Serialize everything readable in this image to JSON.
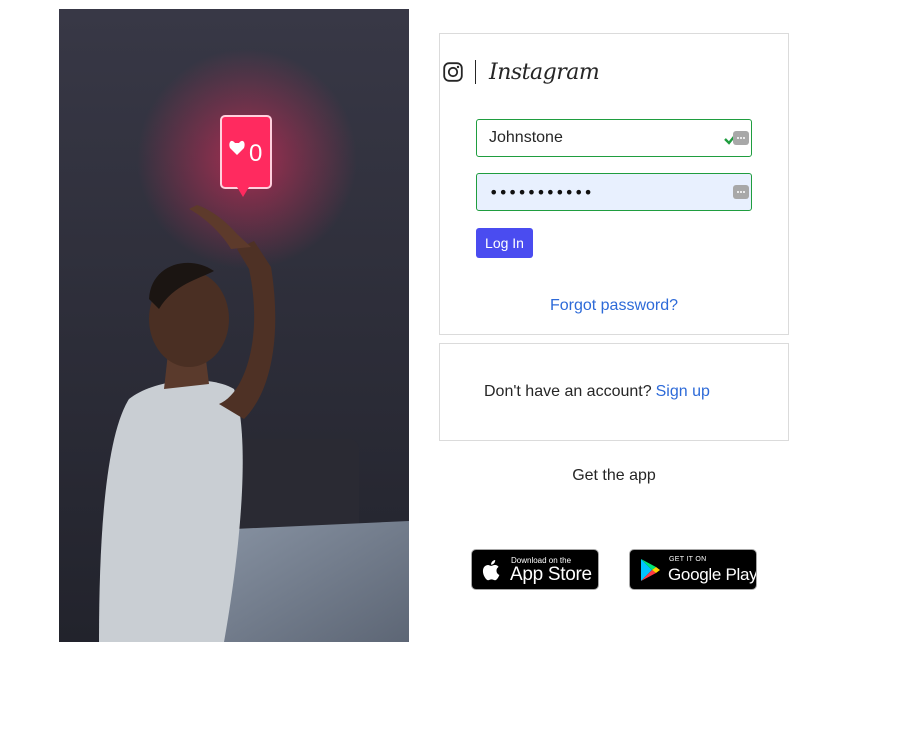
{
  "brand": {
    "wordmark": "Instagram",
    "icon": "instagram-icon"
  },
  "hero": {
    "sign_count": "0",
    "sign_icon": "heart-icon"
  },
  "login": {
    "username_value": "Johnstone",
    "password_mask": "•••••••••••",
    "login_label": "Log In",
    "forgot_label": "Forgot password?",
    "valid_icon": "check-icon",
    "password_manager_icon": "password-manager-icon"
  },
  "signup": {
    "prompt": "Don't have an account?",
    "link_label": "Sign up"
  },
  "apps": {
    "heading": "Get the app",
    "appstore_small": "Download on the",
    "appstore_big": "App Store",
    "google_small": "GET IT ON",
    "google_big": "Google Play"
  },
  "colors": {
    "accent_button": "#4a4cf0",
    "link": "#2d6ad8",
    "valid_border": "#1f9d3f",
    "neon_sign": "#ff2a5f"
  }
}
